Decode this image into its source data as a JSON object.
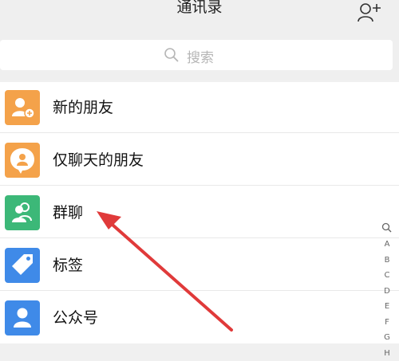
{
  "header": {
    "title": "通讯录",
    "add_contact_icon": "add-contact-icon"
  },
  "search": {
    "placeholder": "搜索",
    "icon": "search-icon"
  },
  "items": [
    {
      "label": "新的朋友",
      "icon": "new-friends-icon",
      "color": "#f4a24a"
    },
    {
      "label": "仅聊天的朋友",
      "icon": "chat-only-friends-icon",
      "color": "#f4a24a"
    },
    {
      "label": "群聊",
      "icon": "group-chat-icon",
      "color": "#3cb878"
    },
    {
      "label": "标签",
      "icon": "tag-icon",
      "color": "#3f8ae8"
    },
    {
      "label": "公众号",
      "icon": "official-account-icon",
      "color": "#3f8ae8"
    }
  ],
  "index_bar": {
    "icon": "index-search-icon",
    "letters": [
      "A",
      "B",
      "C",
      "D",
      "E",
      "F",
      "G",
      "H"
    ]
  },
  "annotation": {
    "color": "#e03a3a"
  }
}
